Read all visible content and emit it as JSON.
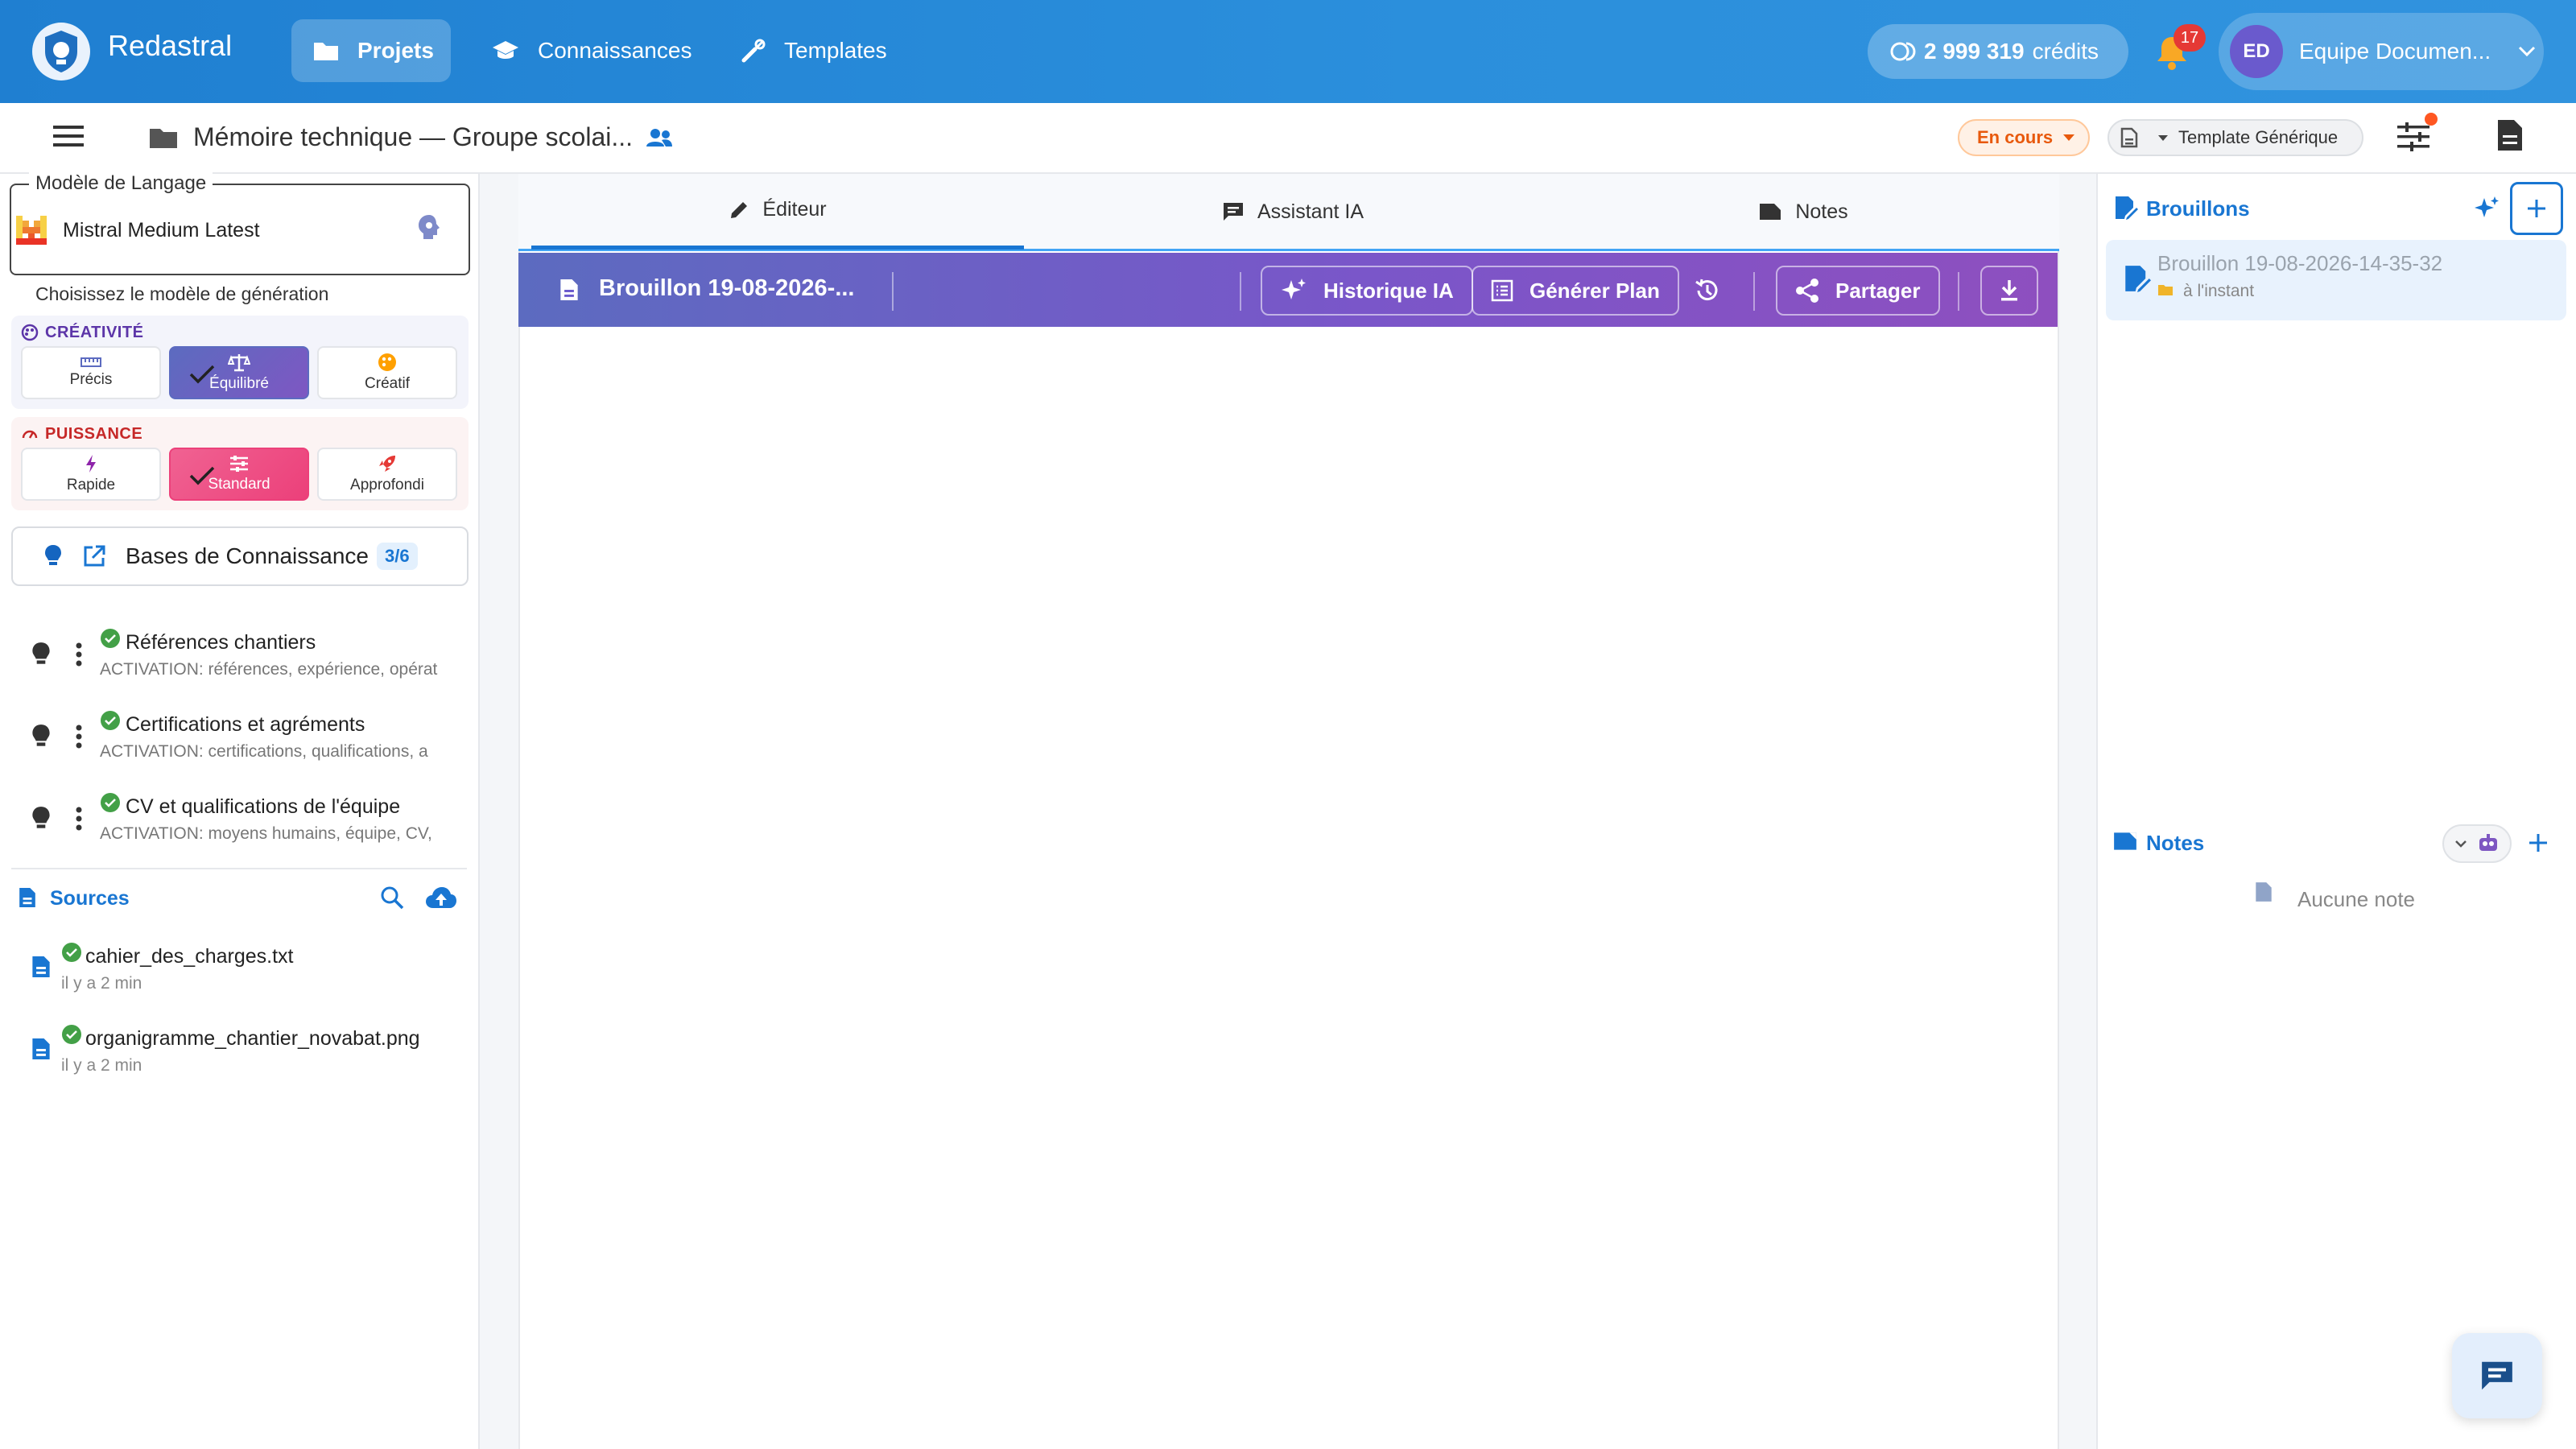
{
  "app": {
    "name": "Redastral"
  },
  "nav": [
    {
      "label": "Projets",
      "icon": "folder-icon",
      "active": true
    },
    {
      "label": "Connaissances",
      "icon": "graduation-cap-icon",
      "active": false
    },
    {
      "label": "Templates",
      "icon": "tools-icon",
      "active": false
    }
  ],
  "credits": {
    "amount": "2 999 319",
    "unit": "crédits"
  },
  "notifications": {
    "count": "17"
  },
  "user": {
    "initials": "ED",
    "name": "Equipe Documen..."
  },
  "document": {
    "title": "Mémoire technique — Groupe scolai..."
  },
  "status": {
    "label": "En cours"
  },
  "template": {
    "label": "Template Générique"
  },
  "model": {
    "legend": "Modèle de Langage",
    "name": "Mistral Medium Latest",
    "hint": "Choisissez le modèle de génération"
  },
  "creativity": {
    "title": "CRÉATIVITÉ",
    "options": [
      "Précis",
      "Équilibré",
      "Créatif"
    ],
    "selected": "Équilibré"
  },
  "power": {
    "title": "PUISSANCE",
    "options": [
      "Rapide",
      "Standard",
      "Approfondi"
    ],
    "selected": "Standard"
  },
  "knowledge": {
    "label": "Bases de Connaissance",
    "count": "3/6",
    "items": [
      {
        "title": "Références chantiers",
        "subtitle": "ACTIVATION: références, expérience, opérat"
      },
      {
        "title": "Certifications et agréments",
        "subtitle": "ACTIVATION: certifications, qualifications, a"
      },
      {
        "title": "CV et qualifications de l'équipe",
        "subtitle": "ACTIVATION: moyens humains, équipe, CV,"
      }
    ]
  },
  "sources": {
    "title": "Sources",
    "items": [
      {
        "name": "cahier_des_charges.txt",
        "time": "il y a 2 min"
      },
      {
        "name": "organigramme_chantier_novabat.png",
        "time": "il y a 2 min"
      }
    ]
  },
  "tabs": [
    {
      "label": "Éditeur",
      "active": true
    },
    {
      "label": "Assistant IA",
      "active": false
    },
    {
      "label": "Notes",
      "active": false
    }
  ],
  "toolbar": {
    "draft_title": "Brouillon 19-08-2026-...",
    "history_label": "Historique IA",
    "plan_label": "Générer Plan",
    "share_label": "Partager"
  },
  "drafts": {
    "title": "Brouillons",
    "items": [
      {
        "name": "Brouillon 19-08-2026-14-35-32",
        "time": "à l'instant"
      }
    ]
  },
  "notes": {
    "title": "Notes",
    "empty": "Aucune note"
  },
  "colors": {
    "primary": "#1976d2",
    "accent_purple": "#7a56c9",
    "accent_pink": "#ec407a",
    "status_orange": "#e8590c",
    "success": "#43a047"
  }
}
